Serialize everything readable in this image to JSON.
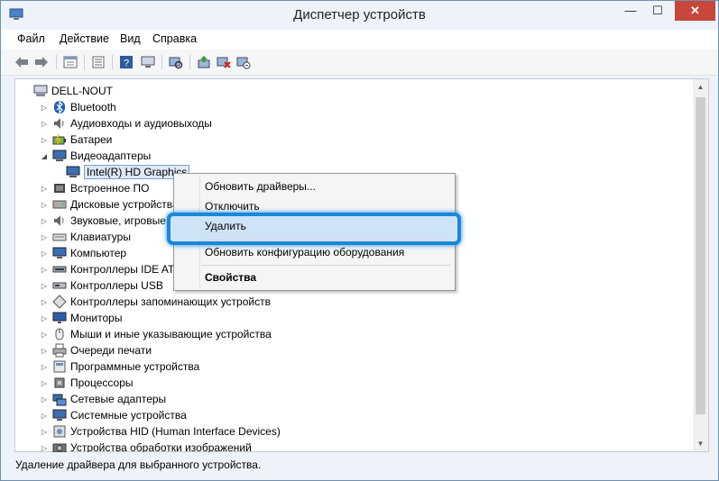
{
  "window": {
    "title": "Диспетчер устройств",
    "minimize_glyph": "—",
    "maximize_glyph": "☐",
    "close_glyph": "✕"
  },
  "menubar": {
    "items": [
      "Файл",
      "Действие",
      "Вид",
      "Справка"
    ]
  },
  "toolbar": {
    "buttons": [
      "back-arrow-icon",
      "forward-arrow-icon",
      "properties-icon",
      "list-icon",
      "help-icon",
      "computer-icon",
      "scan-hardware-icon",
      "update-driver-icon",
      "uninstall-device-icon",
      "enable-device-icon"
    ]
  },
  "tree": {
    "root": "DELL-NOUT",
    "items": [
      {
        "label": "Bluetooth",
        "icon": "bluetooth-icon",
        "expanded": false
      },
      {
        "label": "Аудиовходы и аудиовыходы",
        "icon": "speaker-icon",
        "expanded": false
      },
      {
        "label": "Батареи",
        "icon": "battery-icon",
        "expanded": false
      },
      {
        "label": "Видеоадаптеры",
        "icon": "display-adapter-icon",
        "expanded": true
      },
      {
        "label": "Intel(R) HD Graphics",
        "icon": "display-adapter-icon",
        "child": true,
        "selected": true
      },
      {
        "label": "Встроенное ПО",
        "icon": "firmware-icon",
        "expanded": false
      },
      {
        "label": "Дисковые устройства",
        "icon": "disk-icon",
        "expanded": false
      },
      {
        "label": "Звуковые, игровые и видеоустройства",
        "icon": "speaker-icon",
        "expanded": false
      },
      {
        "label": "Клавиатуры",
        "icon": "keyboard-icon",
        "expanded": false
      },
      {
        "label": "Компьютер",
        "icon": "computer-icon",
        "expanded": false
      },
      {
        "label": "Контроллеры IDE ATA/ATAPI",
        "icon": "ide-controller-icon",
        "expanded": false
      },
      {
        "label": "Контроллеры USB",
        "icon": "usb-icon",
        "expanded": false
      },
      {
        "label": "Контроллеры запоминающих устройств",
        "icon": "storage-controller-icon",
        "expanded": false
      },
      {
        "label": "Мониторы",
        "icon": "monitor-icon",
        "expanded": false
      },
      {
        "label": "Мыши и иные указывающие устройства",
        "icon": "mouse-icon",
        "expanded": false
      },
      {
        "label": "Очереди печати",
        "icon": "printer-icon",
        "expanded": false
      },
      {
        "label": "Программные устройства",
        "icon": "software-device-icon",
        "expanded": false
      },
      {
        "label": "Процессоры",
        "icon": "processor-icon",
        "expanded": false
      },
      {
        "label": "Сетевые адаптеры",
        "icon": "network-adapter-icon",
        "expanded": false
      },
      {
        "label": "Системные устройства",
        "icon": "system-device-icon",
        "expanded": false
      },
      {
        "label": "Устройства HID (Human Interface Devices)",
        "icon": "hid-icon",
        "expanded": false
      },
      {
        "label": "Устройства обработки изображений",
        "icon": "camera-icon",
        "expanded": false
      }
    ]
  },
  "context_menu": {
    "items": [
      {
        "label": "Обновить драйверы..."
      },
      {
        "label": "Отключить"
      },
      {
        "label": "Удалить",
        "highlighted": true
      },
      {
        "label": "Обновить конфигурацию оборудования"
      },
      {
        "label": "Свойства",
        "bold": true
      }
    ]
  },
  "statusbar": {
    "text": "Удаление драйвера для выбранного устройства."
  },
  "colors": {
    "highlight_border": "#1a88d8",
    "close_button": "#c8463b",
    "selection": "#dde8f5"
  }
}
